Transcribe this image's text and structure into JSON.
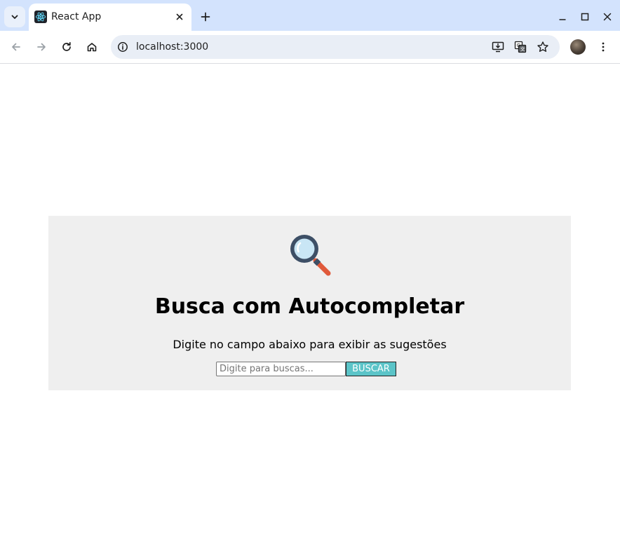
{
  "browser": {
    "tab": {
      "title": "React App",
      "favicon": "react-logo-icon"
    },
    "new_tab_label": "+",
    "window_controls": [
      "minimize-icon",
      "maximize-icon",
      "close-icon"
    ],
    "toolbar": {
      "back": "arrow-left-icon",
      "forward": "arrow-right-icon",
      "reload": "reload-icon",
      "home": "home-icon"
    },
    "omnibox": {
      "url": "localhost:3000",
      "site_info_icon": "info-icon",
      "actions": [
        "install-app-icon",
        "translate-icon",
        "bookmark-star-icon"
      ]
    },
    "menu_icon": "kebab-menu-icon"
  },
  "page": {
    "title": "Busca com Autocompletar",
    "subtitle": "Digite no campo abaixo para exibir as sugestões",
    "search": {
      "placeholder": "Digite para buscas...",
      "value": "",
      "button_label": "BUSCAR"
    },
    "illustration": "magnifying-glass-icon"
  },
  "colors": {
    "tabstrip": "#d3e3fd",
    "omnibox": "#e9eef6",
    "card_background": "#efefef",
    "button_background": "#5bc4c8",
    "glass_frame": "#3d4f66",
    "glass_lens": "#c9e6f5",
    "glass_handle": "#e05a3b"
  }
}
